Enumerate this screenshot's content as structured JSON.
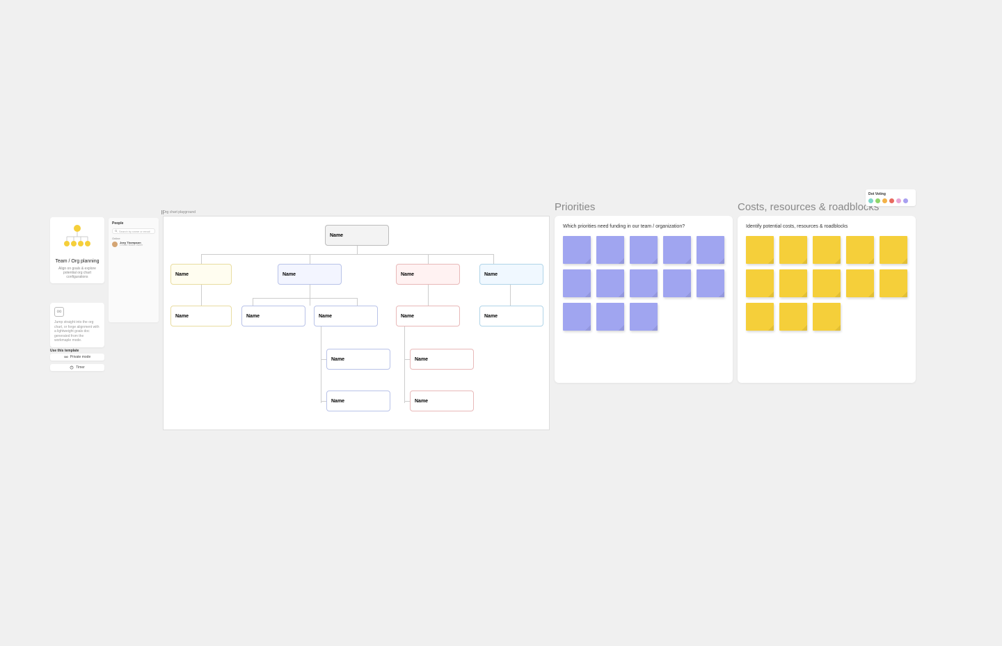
{
  "template": {
    "title": "Team / Org planning",
    "subtitle": "Align on goals & explore potential org chart configurations"
  },
  "note": {
    "text": "Jump straight into the org chart, or forge alignment with a lightweight goals doc generated from the workmaple mode.",
    "icon": "oo"
  },
  "use_section_label": "Use this template",
  "buttons": {
    "private": "Private mode",
    "timer": "Timer"
  },
  "people": {
    "title": "People",
    "search_placeholder": "Search by name or email",
    "online_label": "Online",
    "user": {
      "name": "Joey Thompson",
      "role": "Creator Board Owner"
    }
  },
  "org": {
    "label": "Org chart playground",
    "placeholder": "Name"
  },
  "priorities": {
    "title": "Priorities",
    "prompt": "Which priorities need funding in our team / organization?",
    "sticky_count": 13
  },
  "costs": {
    "title": "Costs, resources & roadblocks",
    "prompt": "Identify potential costs, resources & roadblocks",
    "sticky_count": 13
  },
  "dot_voting": {
    "title": "Dot Voting",
    "colors": [
      "#7ed6c8",
      "#8fd66a",
      "#f3b248",
      "#e86a5f",
      "#e8a5d6",
      "#a8a0f0"
    ]
  }
}
